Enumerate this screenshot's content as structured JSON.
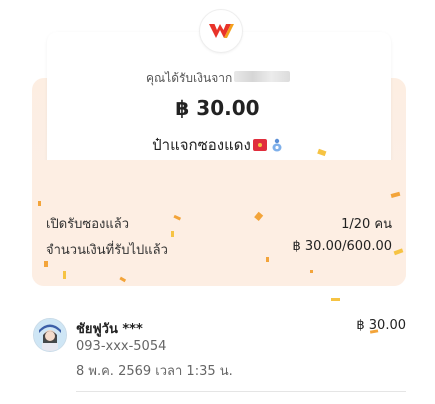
{
  "header": {
    "sender_label": "คุณได้รับเงินจาก",
    "amount": "฿ 30.00",
    "message": "ป๋าแจกซองแดง"
  },
  "stats": {
    "opened_label": "เปิดรับซองแล้ว",
    "opened_value": "1/20 คน",
    "received_label": "จำนวนเงินที่รับไปแล้ว",
    "received_value": "฿ 30.00/600.00"
  },
  "recipient": {
    "name": "ชัยฟูวัน ***",
    "phone": "093-xxx-5054",
    "time": "8 พ.ค. 2569 เวลา 1:35 น.",
    "amount": "฿ 30.00"
  },
  "colors": {
    "logo_red": "#e8332a",
    "logo_orange": "#f4a11b",
    "envelope": "#fdeee3",
    "confetti": "#f3a43a"
  },
  "icons": {
    "logo": "truemoney-wallet-logo",
    "message_emoji_1": "red-envelope-icon",
    "message_emoji_2": "blue-amulet-icon"
  }
}
